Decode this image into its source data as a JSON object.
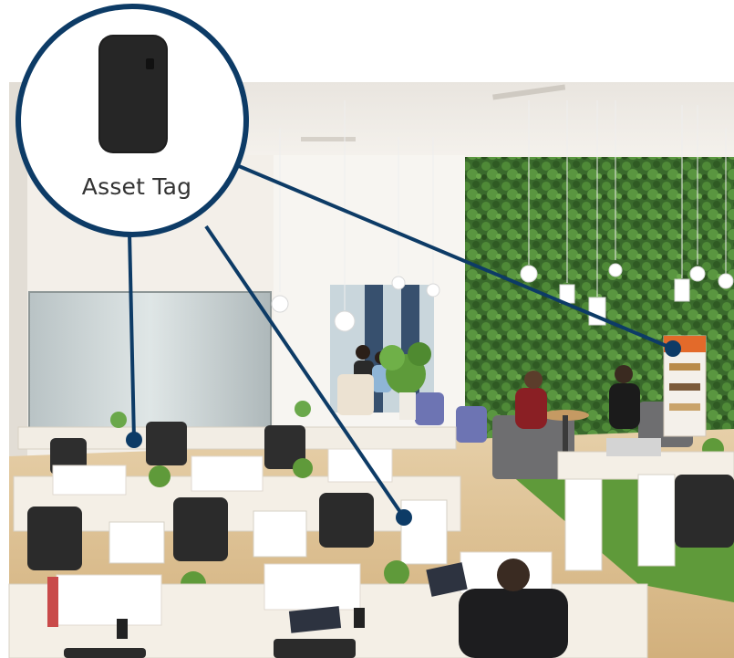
{
  "callout": {
    "label": "Asset Tag",
    "line_color": "#0d3b66",
    "dot_color": "#0d3b66",
    "tag_icon": "asset-tag-device-icon"
  },
  "scene": {
    "description_icon": "office-photo",
    "wall_green": "#3c6b2e",
    "floor_color": "#d9bf96"
  }
}
